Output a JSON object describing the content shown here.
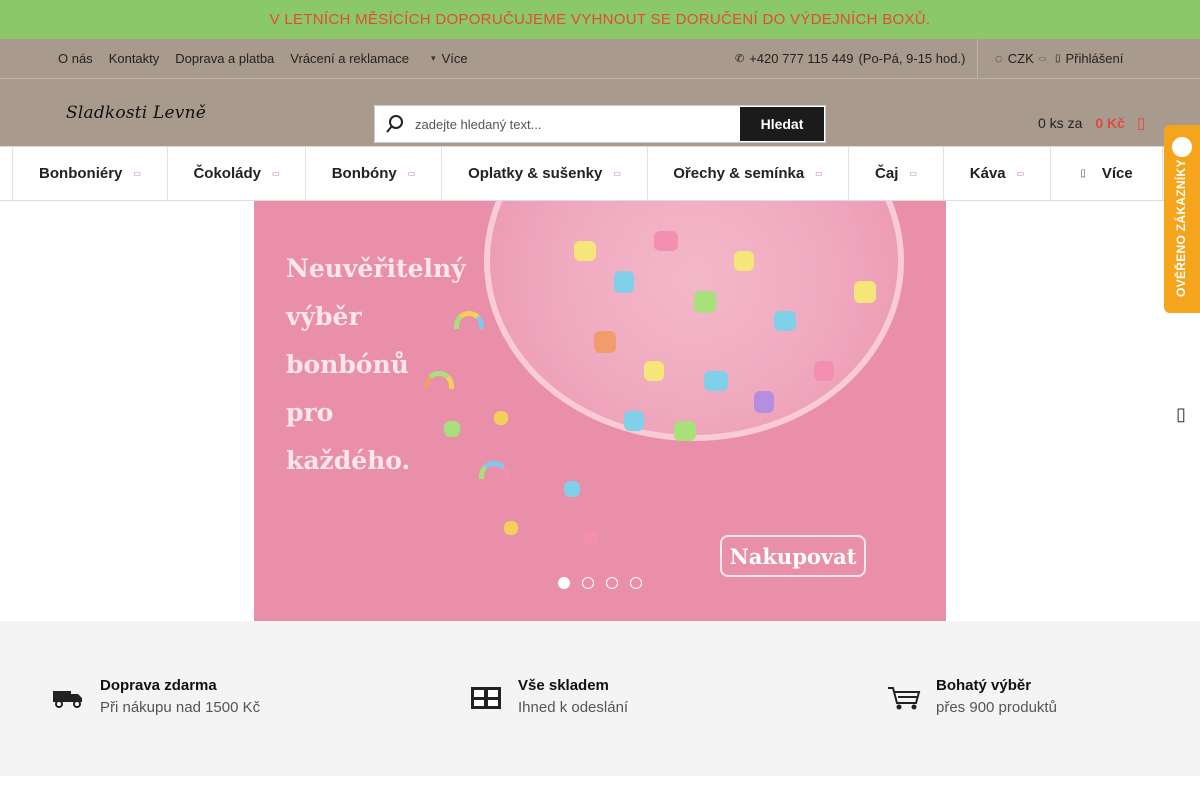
{
  "announcement": "V LETNÍCH MĚSÍCÍCH DOPORUČUJEME VYHNOUT SE DORUČENÍ DO VÝDEJNÍCH BOXŮ.",
  "topbar": {
    "links": [
      "O nás",
      "Kontakty",
      "Doprava a platba",
      "Vrácení a reklamace"
    ],
    "more_label": "Více",
    "phone": "+420 777 115 449",
    "hours": "(Po-Pá, 9-15 hod.)",
    "currency": "CZK",
    "login": "Přihlášení"
  },
  "header": {
    "logo": "Sladkosti Levně",
    "search_placeholder": "zadejte hledaný text...",
    "search_button": "Hledat",
    "cart_count": "0 ks za",
    "cart_price": "0 Kč"
  },
  "nav": {
    "items": [
      "Bonboniéry",
      "Čokolády",
      "Bonbóny",
      "Oplatky & sušenky",
      "Ořechy & semínka",
      "Čaj",
      "Káva"
    ],
    "more_label": "Více"
  },
  "hero": {
    "tagline_lines": [
      "Neuvěřitelný",
      "výběr",
      "bonbónů",
      "pro",
      "každého."
    ],
    "cta": "Nakupovat",
    "slides": 4,
    "active_slide": 1
  },
  "badge": {
    "label": "OVĚŘENO ZÁKAZNÍKY"
  },
  "benefits": [
    {
      "title": "Doprava zdarma",
      "subtitle": "Při nákupu nad 1500 Kč",
      "icon": "truck-icon"
    },
    {
      "title": "Vše skladem",
      "subtitle": "Ihned k odeslání",
      "icon": "warehouse-icon"
    },
    {
      "title": "Bohatý výběr",
      "subtitle": "přes 900 produktů",
      "icon": "cart-icon"
    }
  ],
  "colors": {
    "announce_bg": "#8bc86a",
    "announce_text": "#e24b3b",
    "header_bg": "#a89a8d",
    "accent": "#e04a3c",
    "badge": "#f4a51b",
    "hero_bg": "#ea8faa"
  }
}
